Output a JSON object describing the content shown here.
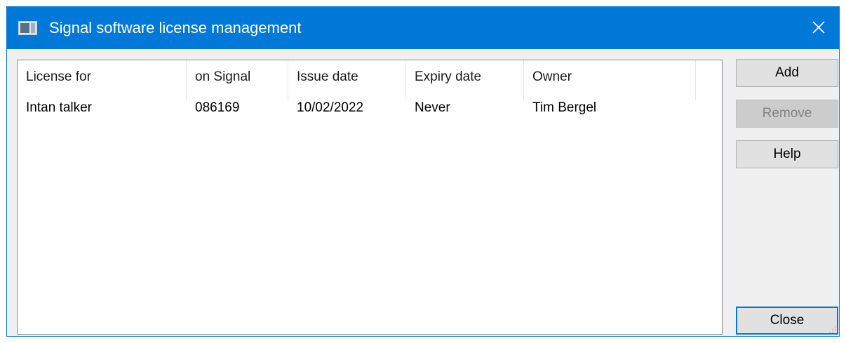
{
  "window": {
    "title": "Signal software license management",
    "icon": "app-window-icon",
    "close_icon": "close-icon"
  },
  "list": {
    "columns": [
      "License for",
      "on Signal",
      "Issue date",
      "Expiry date",
      "Owner"
    ],
    "rows": [
      [
        "Intan talker",
        "086169",
        "10/02/2022",
        "Never",
        "Tim Bergel"
      ]
    ]
  },
  "buttons": {
    "add": "Add",
    "remove": "Remove",
    "help": "Help",
    "close": "Close"
  },
  "colors": {
    "title_bar": "#0078d7",
    "default_button_border": "#0078d7",
    "disabled_text": "#838383"
  }
}
